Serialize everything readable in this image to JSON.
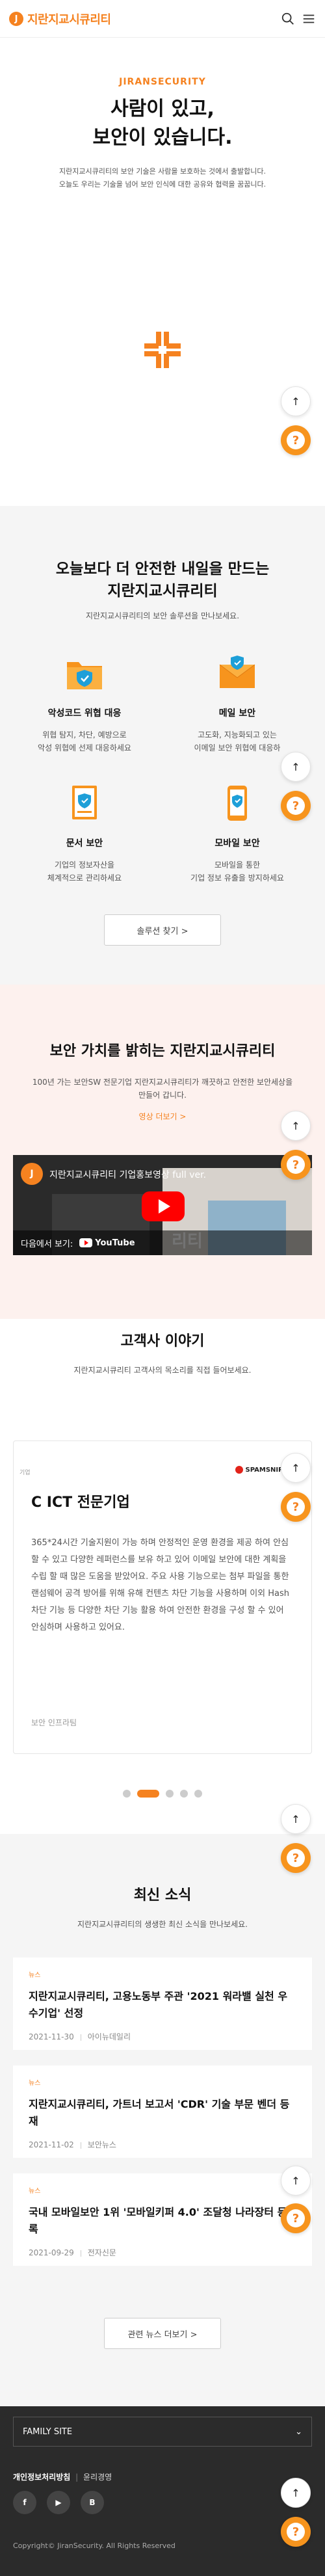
{
  "header": {
    "logo_mark": "J",
    "logo_text": "지란지교시큐리티"
  },
  "intro": {
    "eyebrow": "JIRANSECURITY",
    "title_line1": "사람이 있고,",
    "title_line2": "보안이 있습니다.",
    "text_line1": "지란지교시큐리티의 보안 기술은 사람을 보호하는 것에서 출발합니다.",
    "text_line2": "오늘도 우리는 기술을 넘어 보안 인식에 대한 공유와 협력을 꿈꿉니다."
  },
  "solutions": {
    "title_line1": "오늘보다 더 안전한 내일을 만드는",
    "title_line2": "지란지교시큐리티",
    "subtitle": "지란지교시큐리티의 보안 솔루션을 만나보세요.",
    "items": [
      {
        "name": "악성코드 위협 대응",
        "desc1": "위협 탐지, 차단, 예방으로",
        "desc2": "악성 위협에 선제 대응하세요"
      },
      {
        "name": "메일 보안",
        "desc1": "고도화, 지능화되고 있는",
        "desc2": "이메일 보안 위협에 대응하"
      },
      {
        "name": "문서 보안",
        "desc1": "기업의 정보자산을",
        "desc2": "체계적으로 관리하세요"
      },
      {
        "name": "모바일 보안",
        "desc1": "모바일을 통한",
        "desc2": "기업 정보 유출을 방지하세요"
      }
    ],
    "button_label": "솔루션 찾기 >"
  },
  "video": {
    "title": "보안 가치를 밝히는 지란지교시큐리티",
    "text_line1": "100년 가는 보안SW 전문기업 지란지교시큐리티가 깨끗하고 안전한 보안세상을",
    "text_line2": "만들어 갑니다.",
    "link": "영상 더보기 >",
    "channel_mark": "J",
    "player_title": "지란지교시큐리티 기업홍보영상 full ver.",
    "player_more": "⋮",
    "watch_next": "다음에서 보기:",
    "youtube_label": "YouTube",
    "overlay_text": "리티"
  },
  "testimonials": {
    "title": "고객사 이야기",
    "subtitle": "지란지교시큐리티 고객사의 목소리를 직접 들어보세요.",
    "card": {
      "tag": "기업",
      "logo": "SPAMSNIPER",
      "company": "C ICT 전문기업",
      "body": "365*24시간 기술지원이 가능 하며 안정적인 운영 환경을 제공 하여 안심할 수 있고 다양한 레퍼런스를 보유 하고 있어 이메일 보안에 대한 계획을 수립 할 때 많은 도움을 받았어요. 주요 사용 기능으로는 첨부 파일을 통한 랜섬웨어 공격 방어를 위해 유해 컨텐츠 차단 기능을 사용하며 이외 Hash 차단 기능 등 다양한 차단 기능 활용 하여 안전한 환경을 구성 할 수 있어 안심하며 사용하고 있어요.",
      "author": "보안 인프라팀"
    },
    "slides_total": 5,
    "active_slide": 2
  },
  "news": {
    "title": "최신 소식",
    "subtitle": "지란지교시큐리티의 생생한 최신 소식을 만나보세요.",
    "items": [
      {
        "category": "뉴스",
        "title": "지란지교시큐리티, 고용노동부 주관 '2021 워라밸 실천 우수기업' 선정",
        "date": "2021-11-30",
        "source": "아이뉴데일리"
      },
      {
        "category": "뉴스",
        "title": "지란지교시큐리티, 가트너 보고서 'CDR' 기술 부문 벤더 등재",
        "date": "2021-11-02",
        "source": "보안뉴스"
      },
      {
        "category": "뉴스",
        "title": "국내 모바일보안 1위 '모바일키퍼 4.0' 조달청 나라장터 등록",
        "date": "2021-09-29",
        "source": "전자신문"
      }
    ],
    "button_label": "관련 뉴스 더보기 >"
  },
  "footer": {
    "family_site": "FAMILY SITE",
    "family_arrow": "⌄",
    "privacy": "개인정보처리방침",
    "divider": "|",
    "ethics": "윤리경영",
    "social": [
      "f",
      "▶",
      "B"
    ],
    "copyright": "Copyright© JiranSecurity. All Rights Reserved"
  },
  "floating": {
    "top_arrow": "↑",
    "q_label": "?"
  },
  "colors": {
    "accent": "#f58220",
    "footer_bg": "#2b2b2b"
  }
}
